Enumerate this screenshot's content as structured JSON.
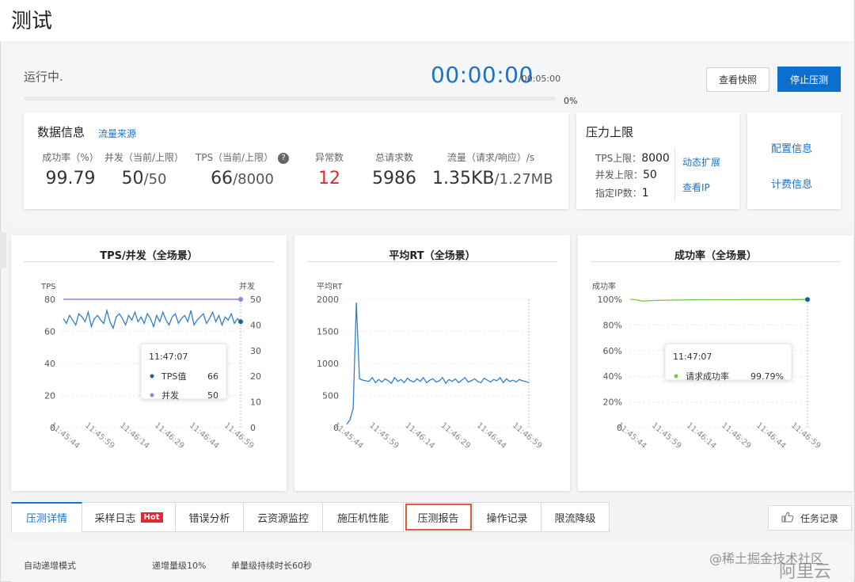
{
  "page": {
    "title": "测试"
  },
  "status": {
    "run_status": "运行中.",
    "timer": "00:00:00",
    "timer_total": "/00:05:00",
    "progress_pct_label": "0%",
    "progress_fraction": 0,
    "snapshot_button": "查看快照",
    "stop_button": "停止压测"
  },
  "data_info": {
    "title": "数据信息",
    "source_link": "流量来源",
    "metrics": [
      {
        "label": "成功率（%）",
        "value": "99.79",
        "sub": ""
      },
      {
        "label": "并发（当前/上限）",
        "value": "50",
        "sub": "/50"
      },
      {
        "label": "TPS（当前/上限）",
        "value": "66",
        "sub": "/8000"
      },
      {
        "label": "异常数",
        "value": "12",
        "sub": ""
      },
      {
        "label": "总请求数",
        "value": "5986",
        "sub": ""
      },
      {
        "label": "流量（请求/响应）/s",
        "value": "1.35KB",
        "sub": "/1.27MB"
      }
    ]
  },
  "pressure": {
    "title": "压力上限",
    "tps_label": "TPS上限：",
    "tps_value": "8000",
    "concurrency_label": "并发上限：",
    "concurrency_value": "50",
    "ip_label": "指定IP数：",
    "ip_value": "1",
    "scale_link": "动态扩展",
    "ip_link": "查看IP"
  },
  "side_links": {
    "config": "配置信息",
    "billing": "计费信息"
  },
  "chart_data": [
    {
      "type": "line",
      "title": "TPS/并发（全场景）",
      "ylabel": "TPS",
      "y2label": "并发",
      "ylim": [
        0,
        80
      ],
      "y2lim": [
        0,
        50
      ],
      "yticks": [
        "0",
        "20",
        "40",
        "60",
        "80"
      ],
      "y2ticks": [
        "0",
        "10",
        "20",
        "30",
        "40",
        "50"
      ],
      "xticks": [
        "11:45:44",
        "11:45:59",
        "11:46:14",
        "11:46:29",
        "11:46:44",
        "11:46:59"
      ],
      "series": [
        {
          "name": "TPS值",
          "axis": "left",
          "color": "#2f7fd0",
          "values": [
            68,
            65,
            70,
            67,
            64,
            71,
            69,
            66,
            72,
            63,
            68,
            70,
            67,
            65,
            73,
            66,
            62,
            69,
            71,
            68,
            64,
            70,
            67,
            72,
            66,
            69,
            65,
            71,
            68,
            63,
            70,
            66,
            72,
            67,
            64,
            69,
            71,
            65,
            68,
            70,
            66,
            73,
            64,
            67,
            69,
            71,
            65,
            68,
            72,
            66,
            70,
            64,
            69,
            67,
            71,
            65,
            68,
            66
          ]
        },
        {
          "name": "并发",
          "axis": "right",
          "color": "#9a7fe0",
          "values": [
            50,
            50,
            50,
            50,
            50,
            50,
            50,
            50,
            50,
            50,
            50,
            50,
            50,
            50,
            50,
            50,
            50,
            50,
            50,
            50,
            50,
            50,
            50,
            50,
            50,
            50,
            50,
            50,
            50,
            50,
            50,
            50,
            50,
            50,
            50,
            50,
            50,
            50,
            50,
            50,
            50,
            50,
            50,
            50,
            50,
            50,
            50,
            50,
            50,
            50,
            50,
            50,
            50,
            50,
            50,
            50,
            50,
            50
          ]
        }
      ],
      "tooltip": {
        "time": "11:47:07",
        "rows": [
          {
            "name": "TPS值",
            "value": "66"
          },
          {
            "name": "并发",
            "value": "50"
          }
        ]
      }
    },
    {
      "type": "line",
      "title": "平均RT（全场景）",
      "ylabel": "平均RT",
      "ylim": [
        0,
        2000
      ],
      "yticks": [
        "0",
        "500",
        "1000",
        "1500",
        "2000"
      ],
      "xticks": [
        "11:45:44",
        "11:45:59",
        "11:46:14",
        "11:46:29",
        "11:46:44",
        "11:46:59"
      ],
      "series": [
        {
          "name": "平均RT",
          "color": "#2f7fd0",
          "values": [
            50,
            120,
            300,
            1950,
            760,
            740,
            730,
            720,
            780,
            700,
            750,
            710,
            760,
            730,
            690,
            780,
            720,
            750,
            700,
            770,
            730,
            710,
            760,
            720,
            780,
            700,
            740,
            760,
            710,
            730,
            780,
            690,
            750,
            720,
            760,
            700,
            740,
            780,
            710,
            730,
            760,
            720,
            700,
            770,
            740,
            710,
            750,
            730,
            780,
            700,
            760,
            720,
            740,
            710,
            750,
            730,
            720,
            700
          ]
        }
      ]
    },
    {
      "type": "line",
      "title": "成功率（全场景）",
      "ylabel": "成功率",
      "ylim": [
        0,
        100
      ],
      "yticks": [
        "0",
        "20%",
        "40%",
        "60%",
        "80%",
        "100%"
      ],
      "xticks": [
        "11:45:44",
        "11:45:59",
        "11:46:14",
        "11:46:29",
        "11:46:44",
        "11:46:59"
      ],
      "series": [
        {
          "name": "请求成功率",
          "color": "#7ac943",
          "values": [
            100,
            99.6,
            98.6,
            98.9,
            99.1,
            99.2,
            99.3,
            99.4,
            99.45,
            99.5,
            99.55,
            99.6,
            99.62,
            99.64,
            99.66,
            99.68,
            99.7,
            99.71,
            99.72,
            99.73,
            99.74,
            99.75,
            99.76,
            99.77,
            99.77,
            99.78,
            99.78,
            99.79,
            99.79,
            99.79
          ]
        }
      ],
      "tooltip": {
        "time": "11:47:07",
        "rows": [
          {
            "name": "请求成功率",
            "value": "99.79%"
          }
        ]
      }
    }
  ],
  "tabs": [
    {
      "label": "压测详情",
      "active": true,
      "hot": false,
      "highlight": false
    },
    {
      "label": "采样日志",
      "active": false,
      "hot": true,
      "highlight": false
    },
    {
      "label": "错误分析",
      "active": false,
      "hot": false,
      "highlight": false
    },
    {
      "label": "云资源监控",
      "active": false,
      "hot": false,
      "highlight": false
    },
    {
      "label": "施压机性能",
      "active": false,
      "hot": false,
      "highlight": false
    },
    {
      "label": "压测报告",
      "active": false,
      "hot": false,
      "highlight": true
    },
    {
      "label": "操作记录",
      "active": false,
      "hot": false,
      "highlight": false
    },
    {
      "label": "限流降级",
      "active": false,
      "hot": false,
      "highlight": false
    }
  ],
  "hot_badge": "Hot",
  "task_button": "任务记录",
  "bottom": {
    "mode": "自动递增模式",
    "step": "递增量级10%",
    "duration": "单量级持续时长60秒"
  },
  "watermark": "@稀土掘金技术社区",
  "watermark2": "阿里云"
}
